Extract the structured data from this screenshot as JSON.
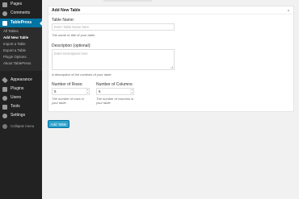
{
  "sidebar": {
    "items": [
      {
        "label": "Pages",
        "icon": "pages-icon"
      },
      {
        "label": "Comments",
        "icon": "comments-icon"
      },
      {
        "label": "TablePress",
        "icon": "tablepress-icon"
      },
      {
        "label": "Appearance",
        "icon": "appearance-icon"
      },
      {
        "label": "Plugins",
        "icon": "plugins-icon"
      },
      {
        "label": "Users",
        "icon": "users-icon"
      },
      {
        "label": "Tools",
        "icon": "tools-icon"
      },
      {
        "label": "Settings",
        "icon": "settings-icon"
      },
      {
        "label": "Collapse menu",
        "icon": "collapse-icon"
      }
    ],
    "submenu": [
      "All Tables",
      "Add New Table",
      "Import a Table",
      "Export a Table",
      "Plugin Options",
      "About TablePress"
    ]
  },
  "postbox": {
    "title": "Add New Table",
    "table_name": {
      "label": "Table Name:",
      "placeholder": "Enter Table Name here",
      "desc": "The name or title of your table."
    },
    "description": {
      "label": "Description (optional):",
      "placeholder": "Enter Description here",
      "desc": "A description of the contents of your table."
    },
    "rows": {
      "label": "Number of Rows:",
      "value": "5",
      "desc_1": "The number of rows in",
      "desc_2": "your table."
    },
    "columns": {
      "label": "Number of Columns:",
      "value": "5",
      "desc_1": "The number of columns in",
      "desc_2": "your table."
    }
  },
  "submit_label": "Add Table",
  "colors": {
    "sidebar_bg": "#222222",
    "active_bg": "#0074a2",
    "button_bg": "#2ea2cc"
  }
}
